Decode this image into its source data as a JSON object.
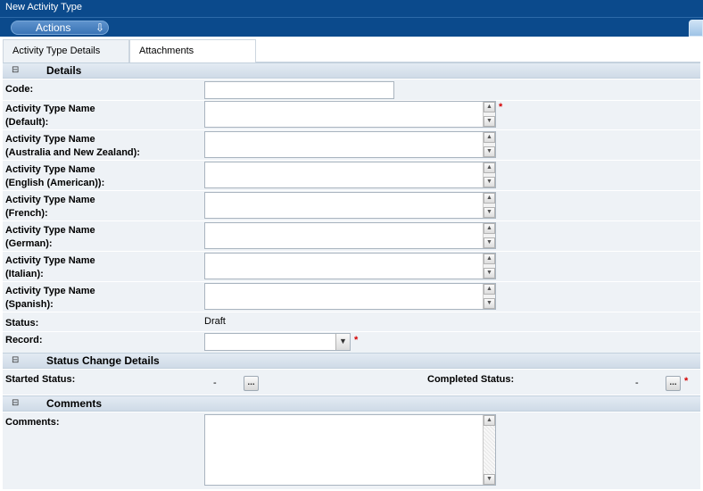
{
  "window": {
    "title": "New Activity Type"
  },
  "toolbar": {
    "actions_label": "Actions",
    "actions_icon": "⇩"
  },
  "tabs": [
    {
      "label": "Activity Type Details",
      "active": true
    },
    {
      "label": "Attachments",
      "active": false
    }
  ],
  "sections": {
    "details": {
      "title": "Details",
      "toggle": "⊟"
    },
    "status_change": {
      "title": "Status Change Details",
      "toggle": "⊟"
    },
    "comments": {
      "title": "Comments",
      "toggle": "⊟"
    }
  },
  "details": {
    "code_label": "Code:",
    "code_value": "",
    "names": [
      {
        "line1": "Activity Type Name",
        "line2": "(Default):",
        "value": "",
        "required": true
      },
      {
        "line1": "Activity Type Name",
        "line2": "(Australia and New Zealand):",
        "value": "",
        "required": false
      },
      {
        "line1": "Activity Type Name",
        "line2": "(English (American)):",
        "value": "",
        "required": false
      },
      {
        "line1": "Activity Type Name",
        "line2": "(French):",
        "value": "",
        "required": false
      },
      {
        "line1": "Activity Type Name",
        "line2": "(German):",
        "value": "",
        "required": false
      },
      {
        "line1": "Activity Type Name",
        "line2": "(Italian):",
        "value": "",
        "required": false
      },
      {
        "line1": "Activity Type Name",
        "line2": "(Spanish):",
        "value": "",
        "required": false
      }
    ],
    "status_label": "Status:",
    "status_value": "Draft",
    "record_label": "Record:",
    "record_value": "",
    "required_marker": "*"
  },
  "status_change": {
    "started_label": "Started Status:",
    "started_value": "-",
    "completed_label": "Completed Status:",
    "completed_value": "-",
    "lookup_label": "..."
  },
  "comments": {
    "label": "Comments:",
    "value": ""
  }
}
